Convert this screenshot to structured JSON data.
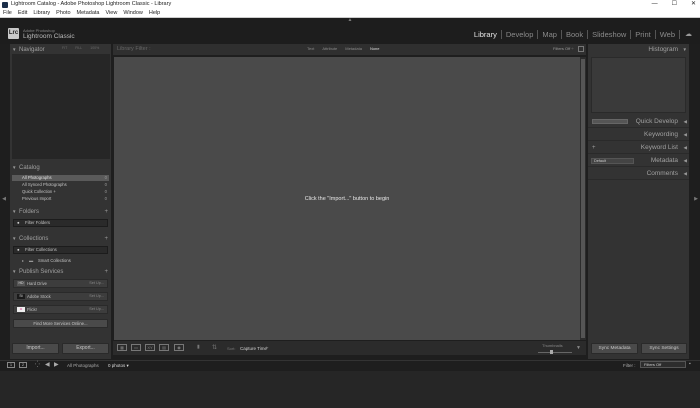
{
  "window": {
    "title": "Lightroom Catalog - Adobe Photoshop Lightroom Classic - Library",
    "controls": [
      "—",
      "☐",
      "✕"
    ]
  },
  "menu": [
    "File",
    "Edit",
    "Library",
    "Photo",
    "Metadata",
    "View",
    "Window",
    "Help"
  ],
  "brand": {
    "logo": "Lrc",
    "line1": "Adobe Photoshop",
    "line2": "Lightroom Classic"
  },
  "modules": [
    "Library",
    "Develop",
    "Map",
    "Book",
    "Slideshow",
    "Print",
    "Web"
  ],
  "active_module": "Library",
  "left": {
    "navigator": {
      "title": "Navigator",
      "options": [
        "FIT",
        "FILL",
        "100%"
      ]
    },
    "catalog": {
      "title": "Catalog",
      "items": [
        {
          "label": "All Photographs",
          "count": "0"
        },
        {
          "label": "All Synced Photographs",
          "count": "0"
        },
        {
          "label": "Quick Collection +",
          "count": "0"
        },
        {
          "label": "Previous Import",
          "count": "0"
        }
      ]
    },
    "folders": {
      "title": "Folders",
      "filter_placeholder": "Filter Folders"
    },
    "collections": {
      "title": "Collections",
      "filter_placeholder": "Filter Collections",
      "smart": "Smart Collections"
    },
    "publish": {
      "title": "Publish Services",
      "services": [
        {
          "icon": "HD",
          "label": "Hard Drive",
          "action": "Set Up..."
        },
        {
          "icon": "St",
          "label": "Adobe Stock",
          "action": "Set Up..."
        },
        {
          "icon": "••",
          "label": "Flickr",
          "action": "Set Up..."
        }
      ],
      "find_more": "Find More Services Online..."
    },
    "import_label": "Import...",
    "export_label": "Export..."
  },
  "center": {
    "filter_title": "Library Filter :",
    "filter_tabs": [
      "Text",
      "Attribute",
      "Metadata",
      "None"
    ],
    "filter_active": "None",
    "filters_off": "Filters Off",
    "hint": "Click the \"Import...\" button to begin",
    "sort_label": "Sort:",
    "sort_value": "Capture Time",
    "thumbnails_label": "Thumbnails"
  },
  "right": {
    "histogram": "Histogram",
    "quick_develop": "Quick Develop",
    "keywording": "Keywording",
    "keyword_list": "Keyword List",
    "metadata": "Metadata",
    "metadata_preset": "Default",
    "comments": "Comments",
    "sync_metadata": "Sync Metadata",
    "sync_settings": "Sync Settings"
  },
  "filmstrip": {
    "pages": [
      "1",
      "2"
    ],
    "source": "All Photographs",
    "count": "0 photos",
    "filter_label": "Filter :",
    "filter_value": "Filters Off"
  }
}
